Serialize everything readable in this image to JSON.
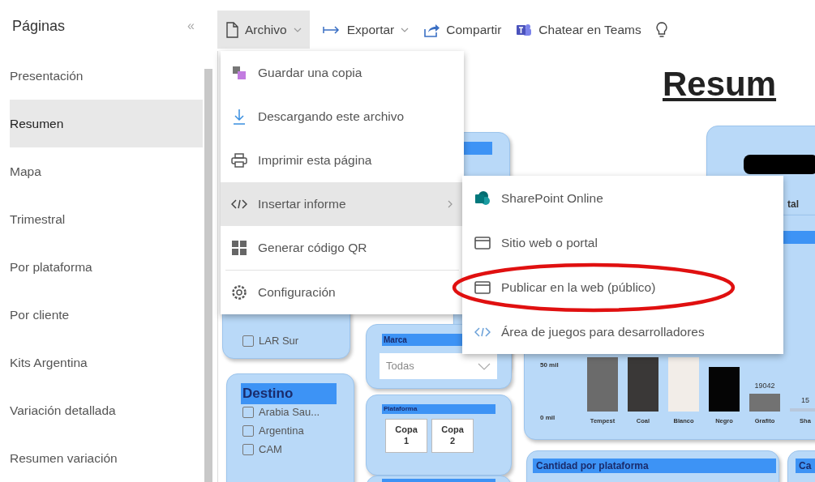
{
  "sidebar": {
    "title": "Páginas",
    "collapse_glyph": "«",
    "items": [
      {
        "label": "Presentación",
        "selected": false
      },
      {
        "label": "Resumen",
        "selected": true
      },
      {
        "label": "Mapa",
        "selected": false
      },
      {
        "label": "Trimestral",
        "selected": false
      },
      {
        "label": "Por plataforma",
        "selected": false
      },
      {
        "label": "Por cliente",
        "selected": false
      },
      {
        "label": "Kits Argentina",
        "selected": false
      },
      {
        "label": "Variación detallada",
        "selected": false
      },
      {
        "label": "Resumen variación",
        "selected": false
      }
    ]
  },
  "toolbar": {
    "items": [
      {
        "label": "Archivo",
        "kind": "dropdown",
        "selected": true
      },
      {
        "label": "Exportar",
        "kind": "dropdown",
        "selected": false
      },
      {
        "label": "Compartir",
        "kind": "button",
        "selected": false
      },
      {
        "label": "Chatear en Teams",
        "kind": "button",
        "selected": false
      },
      {
        "kind": "icon",
        "selected": false
      }
    ]
  },
  "file_menu": {
    "items": [
      {
        "label": "Guardar una copia",
        "selected": false,
        "has_submenu": false,
        "separator_before": false
      },
      {
        "label": "Descargando este archivo",
        "selected": false,
        "has_submenu": false,
        "separator_before": false
      },
      {
        "label": "Imprimir esta página",
        "selected": false,
        "has_submenu": false,
        "separator_before": false
      },
      {
        "label": "Insertar informe",
        "selected": true,
        "has_submenu": true,
        "separator_before": false
      },
      {
        "label": "Generar código QR",
        "selected": false,
        "has_submenu": false,
        "separator_before": false
      },
      {
        "label": "Configuración",
        "selected": false,
        "has_submenu": false,
        "separator_before": true
      }
    ]
  },
  "embed_submenu": {
    "items": [
      {
        "label": "SharePoint Online",
        "circled": false
      },
      {
        "label": "Sitio web o portal",
        "circled": false
      },
      {
        "label": "Publicar en la web (público)",
        "circled": true
      },
      {
        "label": "Área de juegos para desarrolladores",
        "circled": false
      }
    ]
  },
  "report": {
    "title": "Resum",
    "kpi_caption": "tal",
    "region_slicer": {
      "options": [
        {
          "label": "LAR Sur",
          "checked": false
        }
      ]
    },
    "destination_slicer": {
      "title": "Destino",
      "options": [
        {
          "label": "Arabia Sau...",
          "checked": false
        },
        {
          "label": "Argentina",
          "checked": false
        },
        {
          "label": "CAM",
          "checked": false
        }
      ]
    },
    "brand_slicer": {
      "title": "Marca",
      "value": "Todas"
    },
    "platform_slicer": {
      "title": "Plataforma",
      "buttons": [
        {
          "label": "Copa 1"
        },
        {
          "label": "Copa 2"
        }
      ]
    },
    "chart": {
      "y_labels": [
        "50 mil",
        "0 mil"
      ],
      "bars": [
        {
          "label": "Tempest",
          "color": "#6b6b6b"
        },
        {
          "label": "Coal",
          "color": "#3a3837"
        },
        {
          "label": "Blanco",
          "color": "#f2ede8"
        },
        {
          "label": "Negro",
          "color": "#050505"
        },
        {
          "label": "Grafito",
          "color": "#727272",
          "value_label": "19042"
        },
        {
          "label": "Sha",
          "color": "#b8c8dc",
          "value_label": "15"
        }
      ]
    },
    "platform_count": {
      "title": "Cantidad por plataforma"
    },
    "card_cut": {
      "title": "Ca"
    }
  }
}
